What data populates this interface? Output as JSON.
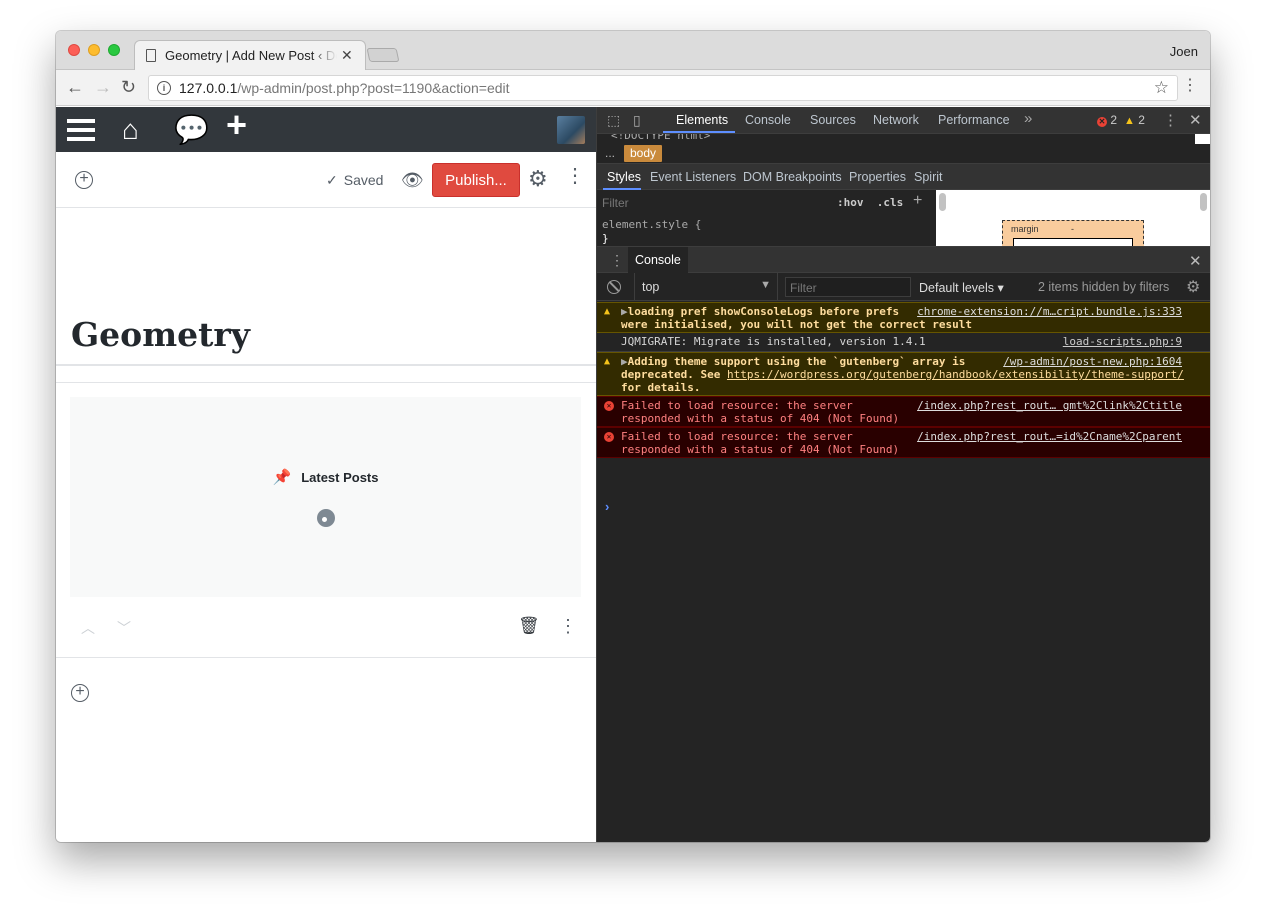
{
  "browser": {
    "tab_title": "Geometry | Add New Post ‹ Do",
    "user": "Joen",
    "url_host": "127.0.0.1",
    "url_path": "/wp-admin/post.php?post=1190&action=edit"
  },
  "editor": {
    "saved_label": "Saved",
    "publish_label": "Publish...",
    "post_title": "Geometry",
    "block_label": "Latest Posts"
  },
  "devtools": {
    "tabs": [
      "Elements",
      "Console",
      "Sources",
      "Network",
      "Performance"
    ],
    "error_count": "2",
    "warning_count": "2",
    "dom_snippet": "<!DOCTYPE html>",
    "breadcrumb_dots": "...",
    "breadcrumb_node": "body",
    "sidebar_tabs": [
      "Styles",
      "Event Listeners",
      "DOM Breakpoints",
      "Properties",
      "Spirit"
    ],
    "styles_filter_placeholder": "Filter",
    "hov": ":hov",
    "cls": ".cls",
    "element_style": "element.style {",
    "element_style_close": "}",
    "margin_label": "margin",
    "margin_value": "-",
    "drawer_tab": "Console",
    "context": "top",
    "console_filter_placeholder": "Filter",
    "levels": "Default levels",
    "hidden_note": "2 items hidden by filters",
    "messages": [
      {
        "level": "warning",
        "text1": "loading pref showConsoleLogs before prefs",
        "text2": "were initialised, you will not get the correct result",
        "source": "chrome-extension://m…cript.bundle.js:333"
      },
      {
        "level": "log",
        "text1": "JQMIGRATE: Migrate is installed, version 1.4.1",
        "source": "load-scripts.php:9"
      },
      {
        "level": "warning",
        "text1": "Adding theme support using the `gutenberg` array is",
        "text2_prefix": "deprecated. See ",
        "text2_link": "https://wordpress.org/gutenberg/handbook/extensibility/theme-support/",
        "text3": "for details.",
        "source": "/wp-admin/post-new.php:1604"
      },
      {
        "level": "error",
        "text1": "Failed to load resource: the server",
        "text2": "responded with a status of 404 (Not Found)",
        "source": "/index.php?rest_rout… gmt%2Clink%2Ctitle"
      },
      {
        "level": "error",
        "text1": "Failed to load resource: the server",
        "text2": "responded with a status of 404 (Not Found)",
        "source": "/index.php?rest_rout…=id%2Cname%2Cparent"
      }
    ],
    "prompt": "›"
  }
}
